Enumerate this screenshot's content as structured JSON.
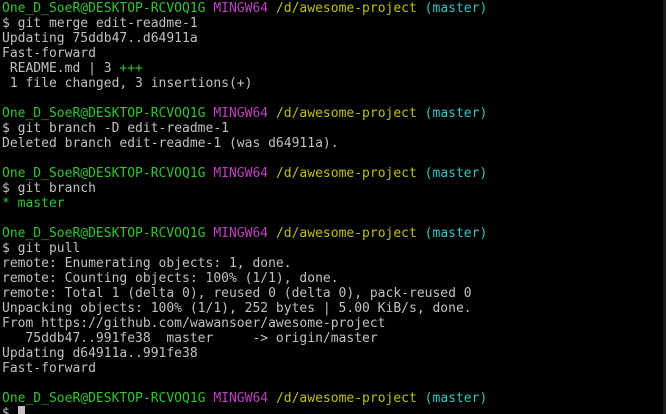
{
  "colors": {
    "background": "#000000",
    "text": "#c0c0c0",
    "green": "#2ec52e",
    "magenta": "#bf3fbf",
    "yellow": "#c0c000",
    "cyan": "#2ec5c5"
  },
  "prompt": {
    "user_host": "One_D_SoeR@DESKTOP-RCVOQ1G",
    "env": "MINGW64",
    "path": "/d/awesome-project",
    "branch": "(master)",
    "symbol": "$"
  },
  "blocks": [
    {
      "command": "git merge edit-readme-1",
      "output": [
        {
          "text": "Updating 75ddb47..d64911a"
        },
        {
          "text": "Fast-forward"
        },
        {
          "file": " README.md | 3 ",
          "plus": "+++"
        },
        {
          "text": " 1 file changed, 3 insertions(+)"
        }
      ]
    },
    {
      "command": "git branch -D edit-readme-1",
      "output": [
        {
          "text": "Deleted branch edit-readme-1 (was d64911a)."
        }
      ]
    },
    {
      "command": "git branch",
      "output": [
        {
          "current_branch": "* master"
        }
      ]
    },
    {
      "command": "git pull",
      "output": [
        {
          "text": "remote: Enumerating objects: 1, done."
        },
        {
          "text": "remote: Counting objects: 100% (1/1), done."
        },
        {
          "text": "remote: Total 1 (delta 0), reused 0 (delta 0), pack-reused 0"
        },
        {
          "text": "Unpacking objects: 100% (1/1), 252 bytes | 5.00 KiB/s, done."
        },
        {
          "text": "From https://github.com/wawansoer/awesome-project"
        },
        {
          "text": "   75ddb47..991fe38  master     -> origin/master"
        },
        {
          "text": "Updating d64911a..991fe38"
        },
        {
          "text": "Fast-forward"
        }
      ]
    }
  ],
  "final_prompt_symbol": "$"
}
